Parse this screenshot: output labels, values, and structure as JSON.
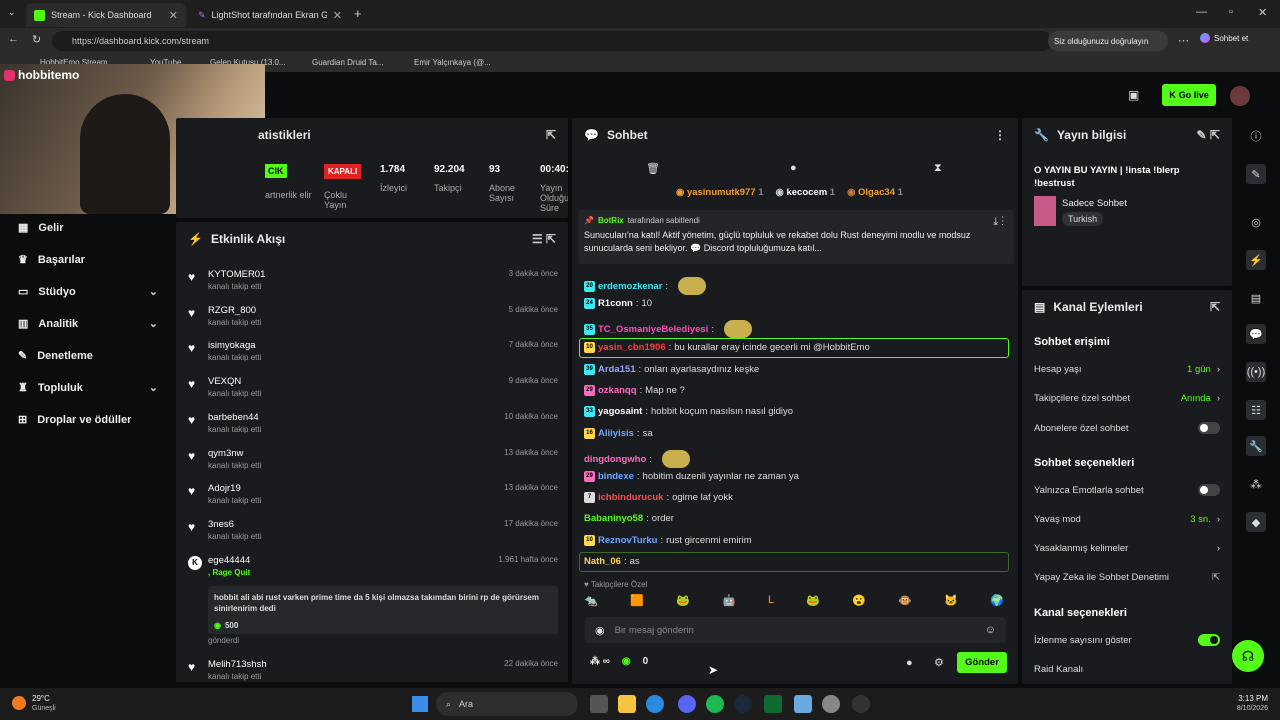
{
  "browser": {
    "tabs": [
      {
        "label": "Stream - Kick Dashboard",
        "active": true
      },
      {
        "label": "LightShot tarafından Ekran Görün",
        "active": false
      }
    ],
    "url": "https://dashboard.kick.com/stream",
    "pill": "Siz olduğunuzu doğrulayın",
    "chat_btn": "Sohbet et",
    "bookmarks": [
      "HobbitEmo Stream",
      "YouTube",
      "Gelen Kutusu (13.0...",
      "Guardian Druid Ta...",
      "Emir Yalçınkaya (@..."
    ]
  },
  "header": {
    "go_live": "Go live",
    "overlay_name": "hobbitemo"
  },
  "sidebar": {
    "items": [
      {
        "label": "Gelir",
        "chev": false
      },
      {
        "label": "Başarılar",
        "chev": false
      },
      {
        "label": "Stüdyo",
        "chev": true
      },
      {
        "label": "Analitik",
        "chev": true
      },
      {
        "label": "Denetleme",
        "chev": false
      },
      {
        "label": "Topluluk",
        "chev": true
      },
      {
        "label": "Droplar ve ödüller",
        "chev": false
      }
    ]
  },
  "stats": {
    "title": "atistikleri",
    "items": [
      {
        "value": "CIK",
        "label": "artnerlik elir"
      },
      {
        "value": "KAPALI",
        "label": "Çoklu Yayın"
      },
      {
        "value": "1.784",
        "label": "İzleyici"
      },
      {
        "value": "92.204",
        "label": "Takipçi"
      },
      {
        "value": "93",
        "label": "Abone Sayısı"
      },
      {
        "value": "00:40:",
        "label": "Yayın Olduğu Süre"
      }
    ]
  },
  "activity": {
    "title": "Etkinlik Akışı",
    "items": [
      {
        "name": "KYTOMER01",
        "sub": "kanalı takip etti",
        "time": "3 dakika önce"
      },
      {
        "name": "RZGR_800",
        "sub": "kanalı takip etti",
        "time": "5 dakika önce"
      },
      {
        "name": "isimyokaga",
        "sub": "kanalı takip etti",
        "time": "7 dakika önce"
      },
      {
        "name": "VEXQN",
        "sub": "kanalı takip etti",
        "time": "9 dakika önce"
      },
      {
        "name": "barbeben44",
        "sub": "kanalı takip etti",
        "time": "10 dakika önce"
      },
      {
        "name": "qym3nw",
        "sub": "kanalı takip etti",
        "time": "13 dakika önce"
      },
      {
        "name": "Adojr19",
        "sub": "kanalı takip etti",
        "time": "13 dakika önce"
      },
      {
        "name": "3nes6",
        "sub": "kanalı takip etti",
        "time": "17 dakika önce"
      }
    ],
    "quit": {
      "name": "ege44444",
      "tag": ", Rage Quit",
      "time": "1.961 hafta önce",
      "text": "hobbit ali abi rust varken prime time da 5 kişi olmazsa takımdan birini rp de görürsem sinirlenirim dedi",
      "amount": "500",
      "sent": "gönderdi"
    },
    "last": {
      "name": "Melih713shsh",
      "sub": "kanalı takip etti",
      "time": "22 dakika önce"
    }
  },
  "chat": {
    "title": "Sohbet",
    "top_gifters": [
      {
        "name": "yasinumutk977",
        "count": "1"
      },
      {
        "name": "kecocem",
        "count": "1"
      },
      {
        "name": "Olgac34",
        "count": "1"
      }
    ],
    "pinned": {
      "by": "BotRix",
      "by_suffix": "tarafından sabitlendi",
      "text": "Sunucuları'na katıl! Aktif yönetim, güçlü topluluk ve rekabet dolu Rust deneyimi modlu ve modsuz sunucularda seni bekliyor. 💬 Discord topluluğumuza katıl..."
    },
    "messages": [
      {
        "user": "erdemozkenar",
        "text": "",
        "color": "#3ee8f0",
        "badge": "20",
        "badge_color": "#3ee8f0"
      },
      {
        "user": "R1conn",
        "text": "10",
        "color": "#ffffff",
        "badge": "24",
        "badge_color": "#3ee8f0"
      },
      {
        "user": "TC_OsmaniyeBelediyesi",
        "text": "",
        "color": "#ff4db8",
        "badge": "35",
        "badge_color": "#3ee8f0"
      },
      {
        "user": "yasin_cbn1906",
        "text": "bu kurallar eray icinde gecerli mi @HobbitEmo",
        "color": "#ff3b3b",
        "badge": "10",
        "badge_color": "#ffd84d"
      },
      {
        "user": "Arda151",
        "text": "onları ayarlasaydınız keşke",
        "color": "#9aa5ff",
        "badge": "39",
        "badge_color": "#3ee8f0"
      },
      {
        "user": "ozkanqq",
        "text": "Map ne ?",
        "color": "#ff6ac1",
        "badge": "29",
        "badge_color": "#ff6ac1"
      },
      {
        "user": "yagosaint",
        "text": "hobbit koçum nasılsın nasıl gidiyo",
        "color": "#ffffff",
        "badge": "33",
        "badge_color": "#3ee8f0"
      },
      {
        "user": "Aliiyisis",
        "text": "sa",
        "color": "#6fa8ff",
        "badge": "16",
        "badge_color": "#ffd84d"
      },
      {
        "user": "dingdongwho",
        "text": "",
        "color": "#ff6ac1",
        "badge": "",
        "badge_color": ""
      },
      {
        "user": "bindexe",
        "text": "hobitim duzenli yayınlar ne zaman ya",
        "color": "#6fa8ff",
        "badge": "29",
        "badge_color": "#ff6ac1"
      },
      {
        "user": "ichbindurucuk",
        "text": "ogime laf yokk",
        "color": "#ff4d4d",
        "badge": "7",
        "badge_color": "#dddddd"
      },
      {
        "user": "Babaninyo58",
        "text": "order",
        "color": "#53fc18",
        "badge": "",
        "badge_color": ""
      },
      {
        "user": "ReznovTurku",
        "text": "rust gircenmi emirim",
        "color": "#6fa8ff",
        "badge": "10",
        "badge_color": "#ffd84d"
      },
      {
        "user": "Nath_06",
        "text": "as",
        "color": "#ffd84d",
        "badge": "",
        "badge_color": ""
      }
    ],
    "followers_only": "Takipçilere Özel",
    "input_placeholder": "Bir mesaj gönderin",
    "points": "0",
    "send": "Gönder"
  },
  "stream_info": {
    "title": "Yayın bilgisi",
    "stream_title": "O YAYIN BU YAYIN | !insta !blerp !bestrust",
    "category": "Sadece Sohbet",
    "language": "Turkish"
  },
  "channel_actions": {
    "title": "Kanal Eylemleri",
    "chat_access": "Sohbet erişimi",
    "account_age": {
      "label": "Hesap yaşı",
      "value": "1 gün"
    },
    "followers_chat": {
      "label": "Takipçilere özel sohbet",
      "value": "Anında"
    },
    "subs_chat": {
      "label": "Abonelere özel sohbet"
    },
    "chat_options": "Sohbet seçenekleri",
    "emote_only": {
      "label": "Yalnızca Emotlarla sohbet"
    },
    "slow_mode": {
      "label": "Yavaş mod",
      "value": "3 sn."
    },
    "banned_words": {
      "label": "Yasaklanmış kelimeler"
    },
    "ai_mod": {
      "label": "Yapay Zeka ile Sohbet Denetimi"
    },
    "channel_options": "Kanal seçenekleri",
    "show_viewers": {
      "label": "İzlenme sayısını göster",
      "on": true
    },
    "raid": {
      "label": "Raid Kanalı"
    }
  },
  "taskbar": {
    "weather_temp": "29°C",
    "weather_label": "Güneşli",
    "search": "Ara",
    "time": "3:13 PM",
    "date": "8/10/2026"
  },
  "colors": {
    "accent": "#53fc18",
    "panel": "#191b1f",
    "bg": "#0b0c0d"
  }
}
